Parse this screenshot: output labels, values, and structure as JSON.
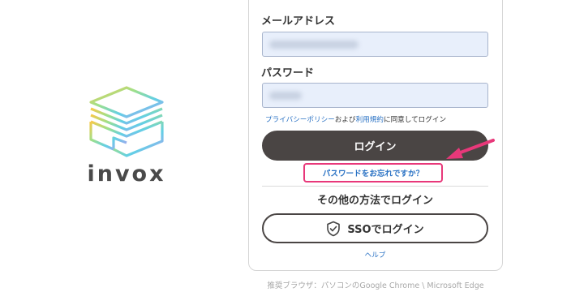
{
  "brand": {
    "name": "invox",
    "gradient": [
      "#f7c94a",
      "#8fdd8a",
      "#5cc9e8",
      "#b39cf0"
    ]
  },
  "form": {
    "email_label": "メールアドレス",
    "email_value": "",
    "password_label": "パスワード",
    "password_value": "",
    "consent": {
      "privacy_link": "プライバシーポリシー",
      "and": "および",
      "terms_link": "利用規約",
      "suffix": "に同意してログイン"
    },
    "login_label": "ログイン",
    "forgot_label": "パスワードをお忘れですか？",
    "other_methods_label": "その他の方法でログイン",
    "sso_label": "SSOでログイン",
    "sso_icon": "shield-check-icon",
    "help_label": "ヘルプ"
  },
  "annotation": {
    "color": "#e8387a"
  },
  "footer": {
    "recommended_browser": "推奨ブラウザ：パソコンのGoogle Chrome \\ Microsoft Edge"
  }
}
